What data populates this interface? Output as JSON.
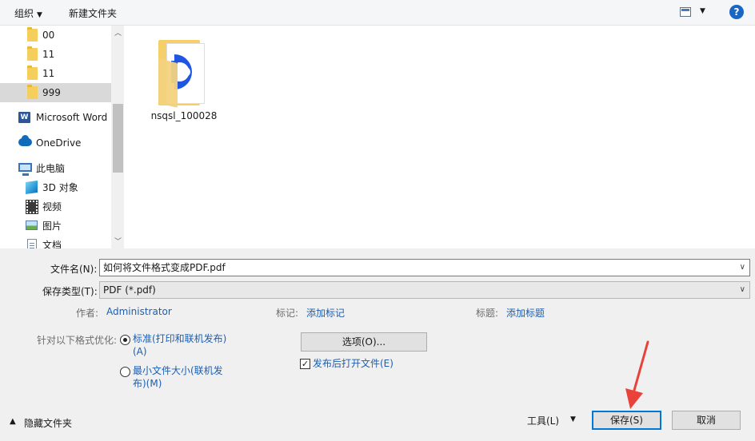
{
  "toolbar": {
    "organize": "组织",
    "new_folder": "新建文件夹",
    "help": "?"
  },
  "nav": {
    "items": [
      {
        "label": "00",
        "icon": "folder-icon"
      },
      {
        "label": "11",
        "icon": "folder-icon"
      },
      {
        "label": "11",
        "icon": "folder-icon"
      },
      {
        "label": "999",
        "icon": "folder-icon",
        "selected": true
      },
      {
        "label": "Microsoft Word",
        "icon": "word-icon"
      },
      {
        "label": "OneDrive",
        "icon": "onedrive-icon"
      },
      {
        "label": "此电脑",
        "icon": "computer-icon"
      },
      {
        "label": "3D 对象",
        "icon": "3d-objects-icon"
      },
      {
        "label": "视频",
        "icon": "video-icon"
      },
      {
        "label": "图片",
        "icon": "pictures-icon"
      },
      {
        "label": "文档",
        "icon": "documents-icon"
      }
    ],
    "word_icon_glyph": "W"
  },
  "files": [
    {
      "name": "nsqsl_100028",
      "icon": "folder-with-app-icon"
    }
  ],
  "form": {
    "filename_label": "文件名(N):",
    "filename_value": "如何将文件格式变成PDF.pdf",
    "type_label": "保存类型(T):",
    "type_value": "PDF (*.pdf)",
    "author_label": "作者:",
    "author_value": "Administrator",
    "tags_label": "标记:",
    "tags_value": "添加标记",
    "title_label": "标题:",
    "title_value": "添加标题",
    "optimize_label": "针对以下格式优化:",
    "option_standard_line1": "标准(打印和联机发布)",
    "option_standard_line2": "(A)",
    "option_min_line1": "最小文件大小(联机发",
    "option_min_line2": "布)(M)",
    "options_button": "选项(O)...",
    "open_after_publish": "发布后打开文件(E)",
    "hide_folders": "隐藏文件夹",
    "tools": "工具(L)",
    "save": "保存(S)",
    "cancel": "取消"
  },
  "colors": {
    "accent": "#0078d7",
    "link": "#1a5fb4",
    "annotation_arrow": "#e8423a"
  }
}
